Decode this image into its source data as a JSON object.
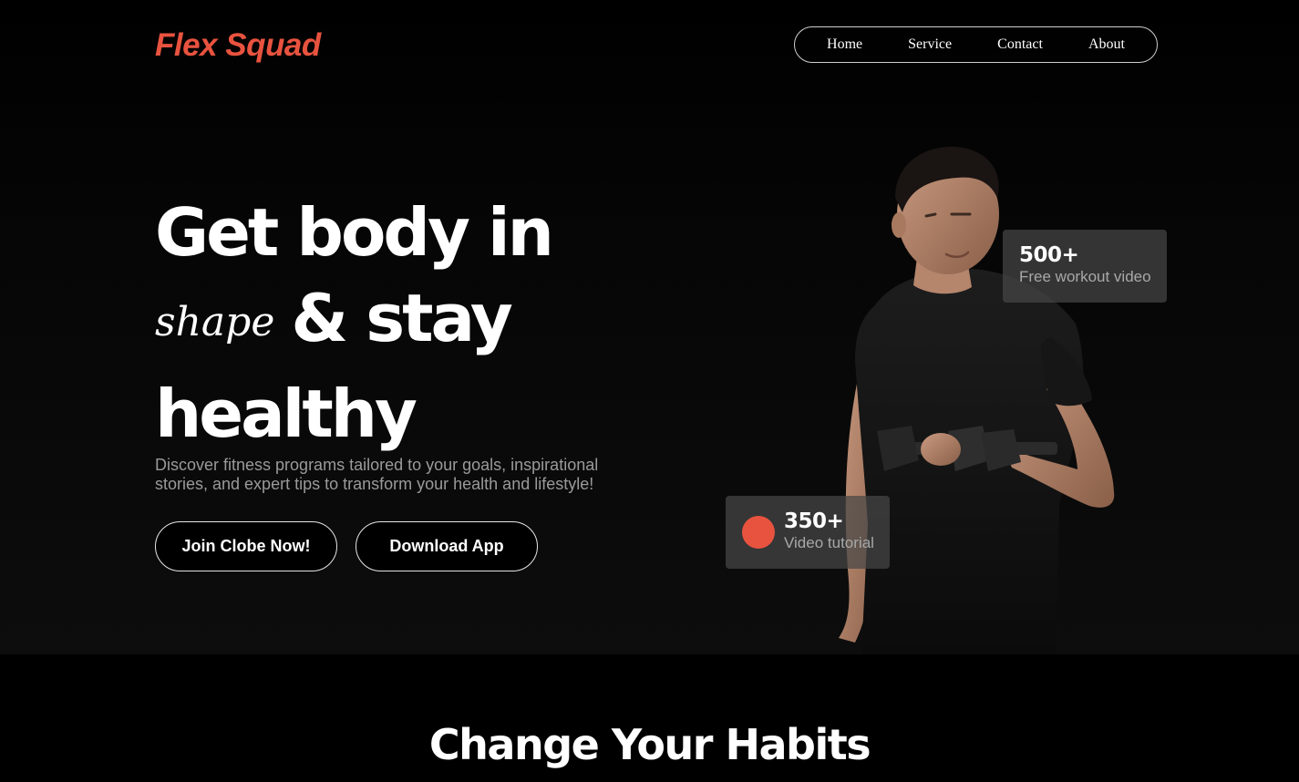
{
  "brand": {
    "logo": "Flex Squad",
    "accent_color": "#e8533f"
  },
  "nav": {
    "items": [
      {
        "label": "Home"
      },
      {
        "label": "Service"
      },
      {
        "label": "Contact"
      },
      {
        "label": "About"
      }
    ]
  },
  "hero": {
    "headline_line1": "Get body in",
    "headline_script": "shape",
    "headline_line2": "& stay",
    "headline_line3": "healthy",
    "description": "Discover fitness programs tailored to your goals, inspirational stories, and expert tips to transform your health and lifestyle!",
    "join_label": "Join Clobe Now!",
    "download_label": "Download App",
    "image_subject": "man-with-dumbbell-photo"
  },
  "stats": [
    {
      "value": "500+",
      "label": "Free workout video"
    },
    {
      "value": "350+",
      "label": "Video tutorial",
      "icon": "orange-dot-icon"
    }
  ],
  "section": {
    "title": "Change Your Habits"
  }
}
